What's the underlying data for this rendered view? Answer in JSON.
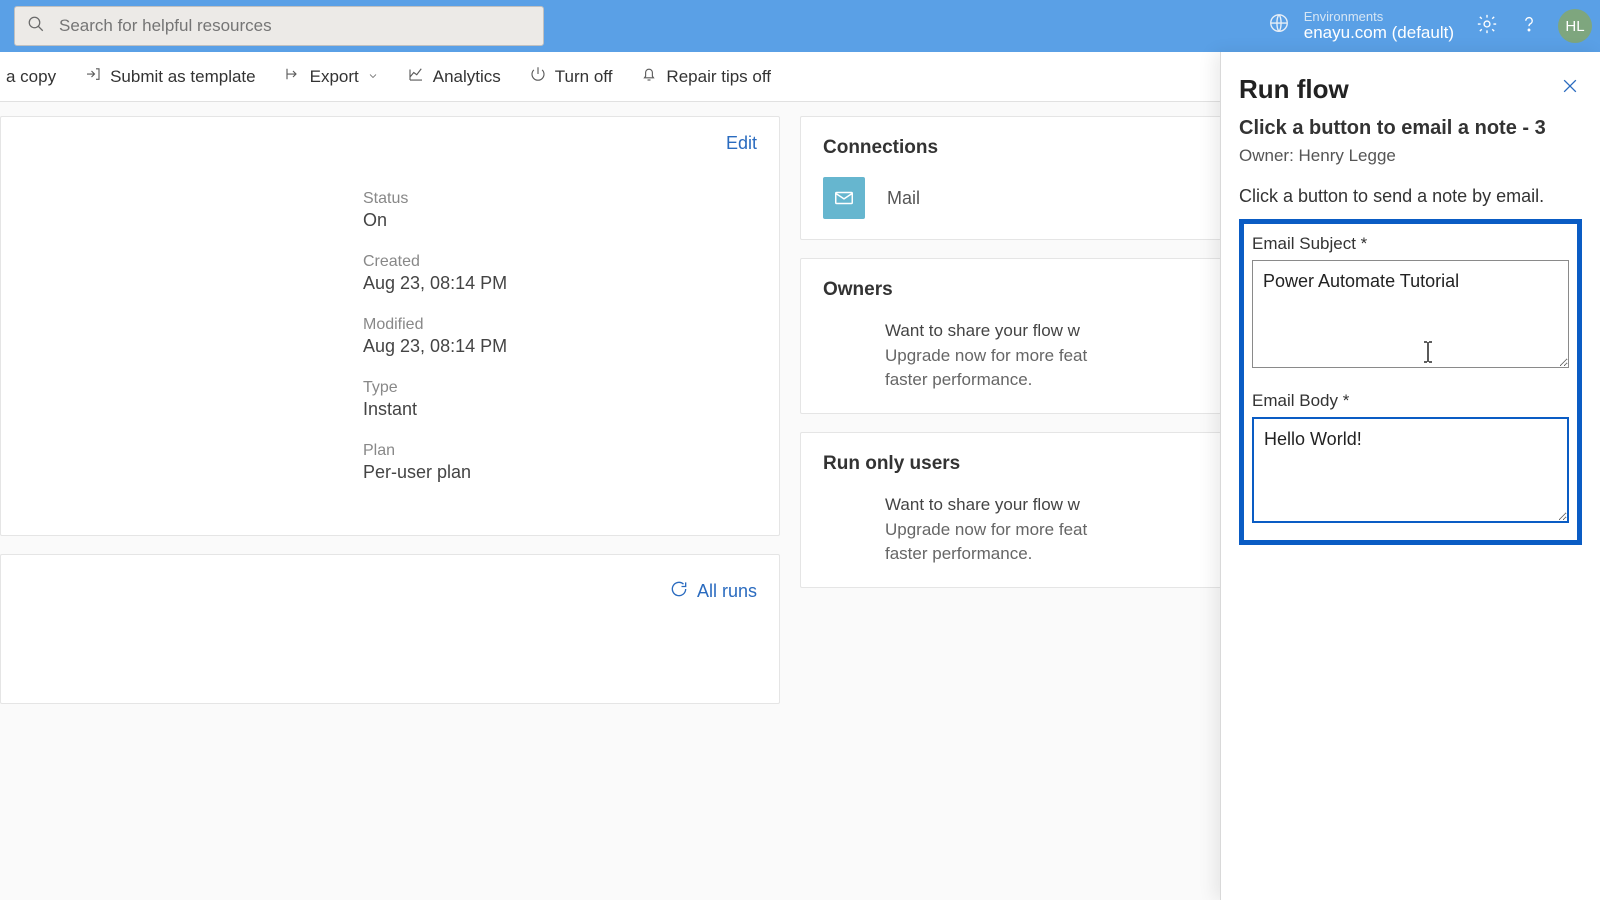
{
  "header": {
    "search_placeholder": "Search for helpful resources",
    "env_label": "Environments",
    "env_name": "enayu.com (default)",
    "avatar_initials": "HL"
  },
  "cmdbar": {
    "copy": "a copy",
    "submit": "Submit as template",
    "export": "Export",
    "analytics": "Analytics",
    "turnoff": "Turn off",
    "repair": "Repair tips off"
  },
  "details_card": {
    "edit": "Edit",
    "status_label": "Status",
    "status_value": "On",
    "created_label": "Created",
    "created_value": "Aug 23, 08:14 PM",
    "modified_label": "Modified",
    "modified_value": "Aug 23, 08:14 PM",
    "type_label": "Type",
    "type_value": "Instant",
    "plan_label": "Plan",
    "plan_value": "Per-user plan"
  },
  "runs_card": {
    "all_runs": "All runs"
  },
  "side": {
    "connections_title": "Connections",
    "connection_name": "Mail",
    "owners_title": "Owners",
    "runonly_title": "Run only users",
    "share_lead": "Want to share your flow w",
    "share_line2": "Upgrade now for more feat",
    "share_line3": "faster performance."
  },
  "panel": {
    "title": "Run flow",
    "flow_name": "Click a button to email a note - 3",
    "owner_line": "Owner: Henry Legge",
    "description": "Click a button to send a note by email.",
    "subject_label": "Email Subject *",
    "subject_value": "Power Automate Tutorial",
    "body_label": "Email Body *",
    "body_value": "Hello World!"
  }
}
